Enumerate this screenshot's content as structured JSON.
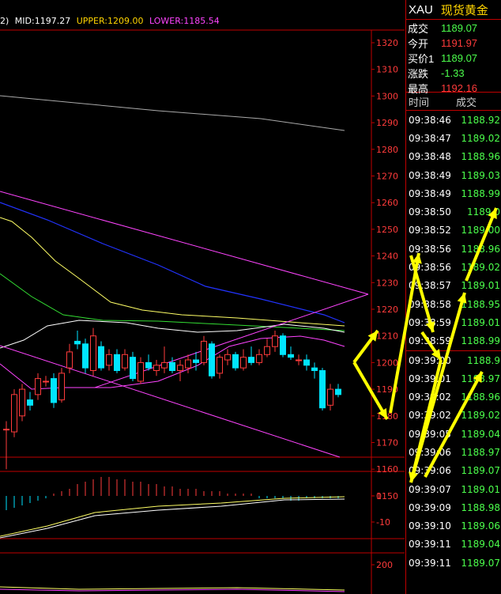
{
  "legend": {
    "prefix": "2)",
    "mid": "MID:1197.27",
    "upper": "UPPER:1209.00",
    "lower": "LOWER:1185.54",
    "mid_color": "#ffffff",
    "upper_color": "#ffd400",
    "lower_color": "#ff44ff"
  },
  "price_axis": [
    "1320",
    "1310",
    "1300",
    "1290",
    "1280",
    "1270",
    "1260",
    "1250",
    "1240",
    "1230",
    "1220",
    "1210",
    "1200",
    "1190",
    "1180",
    "1170",
    "1160",
    "1150"
  ],
  "macd_axis": [
    "0",
    "-10"
  ],
  "vol_axis": [
    "200"
  ],
  "quote": {
    "code": "XAU",
    "name": "现货黄金",
    "rows": [
      {
        "label": "成交",
        "value": "1189.07",
        "color": "#4cff4c"
      },
      {
        "label": "今开",
        "value": "1191.97",
        "color": "#ff3b3b"
      },
      {
        "label": "买价1",
        "value": "1189.07",
        "color": "#4cff4c"
      },
      {
        "label": "涨跌",
        "value": "-1.33",
        "color": "#4cff4c"
      },
      {
        "label": "最高",
        "value": "1192.16",
        "color": "#ff3b3b"
      }
    ]
  },
  "ticks_header": {
    "time": "时间",
    "price": "成交"
  },
  "ticks": [
    {
      "time": "09:38:46",
      "price": "1188.92"
    },
    {
      "time": "09:38:47",
      "price": "1189.02"
    },
    {
      "time": "09:38:48",
      "price": "1188.96"
    },
    {
      "time": "09:38:49",
      "price": "1189.03"
    },
    {
      "time": "09:38:49",
      "price": "1188.99"
    },
    {
      "time": "09:38:50",
      "price": "1189.0"
    },
    {
      "time": "09:38:52",
      "price": "1189.00"
    },
    {
      "time": "09:38:56",
      "price": "1188.96"
    },
    {
      "time": "09:38:56",
      "price": "1189.02"
    },
    {
      "time": "09:38:57",
      "price": "1189.01"
    },
    {
      "time": "09:38:58",
      "price": "1188.95"
    },
    {
      "time": "09:38:59",
      "price": "1189.01"
    },
    {
      "time": "09:38:59",
      "price": "1188.99"
    },
    {
      "time": "09:39:00",
      "price": "1188.9"
    },
    {
      "time": "09:39:01",
      "price": "1188.97"
    },
    {
      "time": "09:39:02",
      "price": "1188.96"
    },
    {
      "time": "09:39:02",
      "price": "1189.02"
    },
    {
      "time": "09:39:05",
      "price": "1189.04"
    },
    {
      "time": "09:39:06",
      "price": "1188.97"
    },
    {
      "time": "09:39:06",
      "price": "1189.07"
    },
    {
      "time": "09:39:07",
      "price": "1189.01"
    },
    {
      "time": "09:39:09",
      "price": "1188.98"
    },
    {
      "time": "09:39:10",
      "price": "1189.06"
    },
    {
      "time": "09:39:11",
      "price": "1189.04"
    },
    {
      "time": "09:39:11",
      "price": "1189.07"
    }
  ],
  "candles": [
    {
      "o": 1175,
      "c": 1175,
      "h": 1178,
      "l": 1160
    },
    {
      "o": 1174,
      "c": 1188,
      "h": 1190,
      "l": 1172
    },
    {
      "o": 1180,
      "c": 1190,
      "h": 1192,
      "l": 1178
    },
    {
      "o": 1186,
      "c": 1184,
      "h": 1189,
      "l": 1182
    },
    {
      "o": 1188,
      "c": 1194,
      "h": 1196,
      "l": 1186
    },
    {
      "o": 1193,
      "c": 1193,
      "h": 1195,
      "l": 1191
    },
    {
      "o": 1194,
      "c": 1185,
      "h": 1196,
      "l": 1183
    },
    {
      "o": 1186,
      "c": 1196,
      "h": 1198,
      "l": 1185
    },
    {
      "o": 1198,
      "c": 1204,
      "h": 1207,
      "l": 1196
    },
    {
      "o": 1208,
      "c": 1207,
      "h": 1212,
      "l": 1205
    },
    {
      "o": 1207,
      "c": 1198,
      "h": 1209,
      "l": 1196
    },
    {
      "o": 1197,
      "c": 1210,
      "h": 1213,
      "l": 1195
    },
    {
      "o": 1206,
      "c": 1198,
      "h": 1208,
      "l": 1197
    },
    {
      "o": 1199,
      "c": 1203,
      "h": 1205,
      "l": 1197
    },
    {
      "o": 1203,
      "c": 1197,
      "h": 1205,
      "l": 1196
    },
    {
      "o": 1198,
      "c": 1203,
      "h": 1205,
      "l": 1197
    },
    {
      "o": 1202,
      "c": 1194,
      "h": 1204,
      "l": 1193
    },
    {
      "o": 1193,
      "c": 1200,
      "h": 1202,
      "l": 1192
    },
    {
      "o": 1200,
      "c": 1198,
      "h": 1203,
      "l": 1197
    },
    {
      "o": 1197,
      "c": 1199,
      "h": 1201,
      "l": 1195
    },
    {
      "o": 1198,
      "c": 1200,
      "h": 1206,
      "l": 1196
    },
    {
      "o": 1200,
      "c": 1197,
      "h": 1202,
      "l": 1196
    },
    {
      "o": 1197,
      "c": 1199,
      "h": 1201,
      "l": 1193
    },
    {
      "o": 1198,
      "c": 1201,
      "h": 1203,
      "l": 1196
    },
    {
      "o": 1201,
      "c": 1200,
      "h": 1204,
      "l": 1197
    },
    {
      "o": 1200,
      "c": 1208,
      "h": 1210,
      "l": 1199
    },
    {
      "o": 1207,
      "c": 1195,
      "h": 1208,
      "l": 1194
    },
    {
      "o": 1196,
      "c": 1202,
      "h": 1203,
      "l": 1194
    },
    {
      "o": 1201,
      "c": 1203,
      "h": 1205,
      "l": 1199
    },
    {
      "o": 1203,
      "c": 1198,
      "h": 1204,
      "l": 1197
    },
    {
      "o": 1198,
      "c": 1202,
      "h": 1205,
      "l": 1197
    },
    {
      "o": 1202,
      "c": 1200,
      "h": 1206,
      "l": 1199
    },
    {
      "o": 1200,
      "c": 1203,
      "h": 1205,
      "l": 1199
    },
    {
      "o": 1203,
      "c": 1206,
      "h": 1209,
      "l": 1202
    },
    {
      "o": 1206,
      "c": 1210,
      "h": 1212,
      "l": 1204
    },
    {
      "o": 1210,
      "c": 1203,
      "h": 1211,
      "l": 1202
    },
    {
      "o": 1203,
      "c": 1202,
      "h": 1206,
      "l": 1201
    },
    {
      "o": 1201,
      "c": 1201,
      "h": 1203,
      "l": 1199
    },
    {
      "o": 1201,
      "c": 1199,
      "h": 1203,
      "l": 1197
    },
    {
      "o": 1198,
      "c": 1197,
      "h": 1200,
      "l": 1194
    },
    {
      "o": 1197,
      "c": 1183,
      "h": 1198,
      "l": 1182
    },
    {
      "o": 1184,
      "c": 1190,
      "h": 1192,
      "l": 1182
    },
    {
      "o": 1190,
      "c": 1188,
      "h": 1192,
      "l": 1187
    }
  ],
  "colors": {
    "up": "#ff3b3b",
    "down": "#00e5ff",
    "axis": "#c00000",
    "label": "#ff3b3b",
    "arrow": "#ffff00"
  }
}
